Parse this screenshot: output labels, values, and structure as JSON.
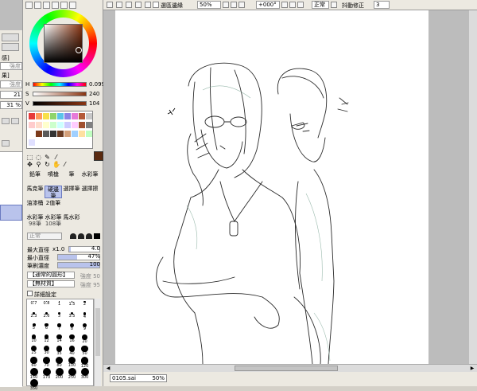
{
  "left_strip": {
    "labels": [
      "感]",
      "果]"
    ],
    "placeholder_value": "強度",
    "numbers": [
      "21",
      "31"
    ],
    "unit": "%"
  },
  "color": {
    "h_label": "H",
    "s_label": "S",
    "v_label": "V",
    "h_value": "0.099",
    "s_value": "240",
    "v_value": "104",
    "current_hex": "#5a2a10"
  },
  "brushes": [
    {
      "label": "鉛筆",
      "size": ""
    },
    {
      "label": "噴槍",
      "size": ""
    },
    {
      "label": "筆",
      "size": ""
    },
    {
      "label": "水彩筆",
      "size": ""
    },
    {
      "label": "馬克筆",
      "size": ""
    },
    {
      "label": "硬邊筆",
      "size": ""
    },
    {
      "label": "選擇筆",
      "size": ""
    },
    {
      "label": "選擇擦",
      "size": ""
    },
    {
      "label": "油漆桶",
      "size": ""
    },
    {
      "label": "2值筆",
      "size": ""
    },
    {
      "label": "",
      "size": ""
    },
    {
      "label": "",
      "size": ""
    },
    {
      "label": "水彩筆",
      "size": "98筆"
    },
    {
      "label": "水彩筆",
      "size": "108筆"
    },
    {
      "label": "馬水彩",
      "size": ""
    },
    {
      "label": "",
      "size": ""
    }
  ],
  "shape": {
    "mode_label": "正常"
  },
  "params": {
    "max_diameter_label": "最大直徑",
    "max_diameter_multiplier": "x1.0",
    "max_diameter_value": "4.0",
    "max_diameter_fill": 0.05,
    "min_diameter_label": "最小直徑",
    "min_diameter_value": "47%",
    "min_diameter_fill": 0.47,
    "density_label": "筆刷濃度",
    "density_value": "100",
    "density_fill": 1.0,
    "shape_label": "【通常的圓形】",
    "shape_strength": "強度",
    "shape_value": "50",
    "texture_label": "【無材質】",
    "texture_strength": "強度",
    "texture_value": "95",
    "detail_label": "詳細設定"
  },
  "sizes": [
    "0.7",
    "0.8",
    "1",
    "1.5",
    "2",
    "2.3",
    "2.6",
    "3",
    "3.5",
    "4",
    "5",
    "6",
    "7",
    "8",
    "9",
    "10",
    "12",
    "14",
    "16",
    "20",
    "25",
    "30",
    "35",
    "40",
    "50",
    "60",
    "70",
    "80",
    "100",
    "120",
    "150",
    "170",
    "200",
    "250",
    "300",
    "350"
  ],
  "toolbar": {
    "stabilize_label": "選區邊緣",
    "zoom_value": "50%",
    "rotate_value": "+000°",
    "blend_mode": "正常",
    "correction_label": "抖動修正",
    "correction_value": "3"
  },
  "document": {
    "filename": "0105.sai",
    "zoom": "50%"
  }
}
